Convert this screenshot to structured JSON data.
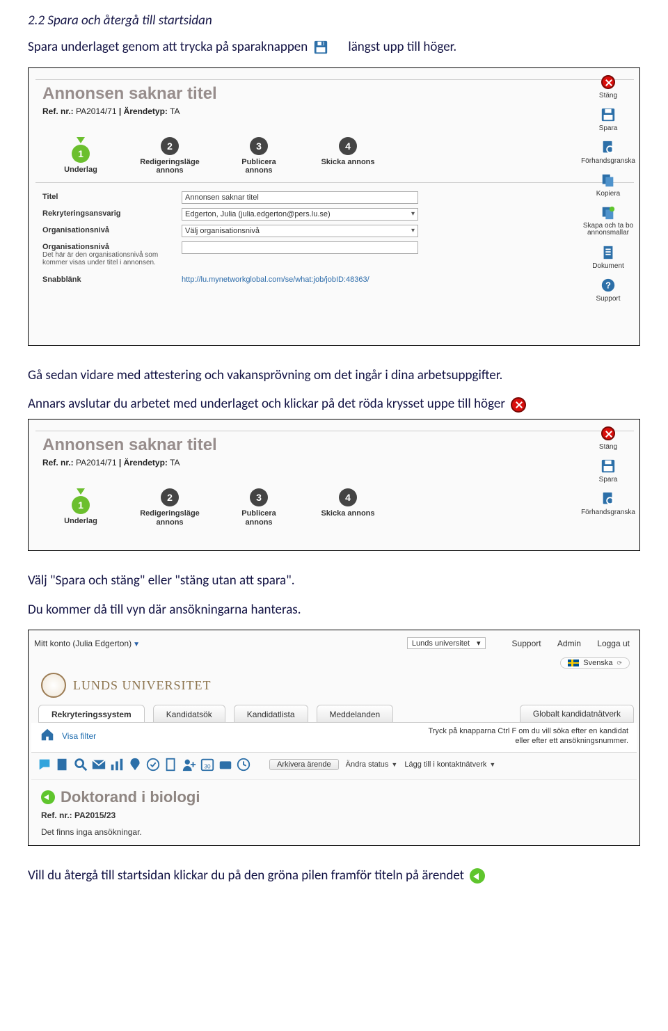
{
  "doc": {
    "heading": "2.2 Spara och återgå till startsidan",
    "p1a": "Spara underlaget genom att trycka på sparaknappen",
    "p1b": "längst upp till höger.",
    "p2": "Gå sedan vidare med attestering och vakansprövning om det ingår i dina arbetsuppgifter.",
    "p3": "Annars avslutar du arbetet med underlaget och klickar på det röda krysset uppe till höger",
    "p4": "Välj \"Spara och stäng\" eller \"stäng utan att spara\".",
    "p5": "Du kommer då till vyn där ansökningarna hanteras.",
    "p6": "Vill du återgå till startsidan klickar du på den gröna pilen framför titeln på ärendet"
  },
  "panel1": {
    "title": "Annonsen saknar titel",
    "ref_lbl": "Ref. nr.:",
    "ref": "PA2014/71",
    "type_lbl": "Ärendetyp:",
    "type": "TA",
    "steps": [
      "Underlag",
      "Redigeringsläge annons",
      "Publicera annons",
      "Skicka annons"
    ],
    "form": {
      "title_lbl": "Titel",
      "title_val": "Annonsen saknar titel",
      "resp_lbl": "Rekryteringsansvarig",
      "resp_val": "Edgerton, Julia (julia.edgerton@pers.lu.se)",
      "org_lbl": "Organisationsnivå",
      "org_val": "Välj organisationsnivå",
      "org2_lbl": "Organisationsnivå",
      "org2_sub": "Det här är den organisationsnivå som kommer visas under titel i annonsen.",
      "quick_lbl": "Snabblänk",
      "quick_val": "http://lu.mynetworkglobal.com/se/what:job/jobID:48363/"
    },
    "actions": {
      "close": "Stäng",
      "save": "Spara",
      "preview": "Förhandsgranska",
      "copy": "Kopiera",
      "template": "Skapa och ta bo annonsmallar",
      "doc": "Dokument",
      "support": "Support"
    }
  },
  "panel2": {
    "title": "Annonsen saknar titel",
    "ref_lbl": "Ref. nr.:",
    "ref": "PA2014/71",
    "type_lbl": "Ärendetyp:",
    "type": "TA",
    "steps": [
      "Underlag",
      "Redigeringsläge annons",
      "Publicera annons",
      "Skicka annons"
    ],
    "actions": {
      "close": "Stäng",
      "save": "Spara",
      "preview": "Förhandsgranska"
    }
  },
  "dash": {
    "account": "Mitt konto (Julia Edgerton)",
    "org": "Lunds universitet",
    "support": "Support",
    "admin": "Admin",
    "logout": "Logga ut",
    "lang": "Svenska",
    "brand": "LUNDS UNIVERSITET",
    "tabs": {
      "t1": "Rekryteringssystem",
      "t2": "Kandidatsök",
      "t3": "Kandidatlista",
      "t4": "Meddelanden",
      "t5": "Globalt kandidatnätverk"
    },
    "filter": "Visa filter",
    "hint": "Tryck på knapparna Ctrl F om du vill söka efter en kandidat eller efter ett ansökningsnummer.",
    "archive_btn": "Arkivera ärende",
    "status": "Ändra status",
    "addnet": "Lägg till i kontaktnätverk",
    "job_title": "Doktorand i biologi",
    "ref2_lbl": "Ref. nr.:",
    "ref2": "PA2015/23",
    "noapps": "Det finns inga ansökningar."
  }
}
